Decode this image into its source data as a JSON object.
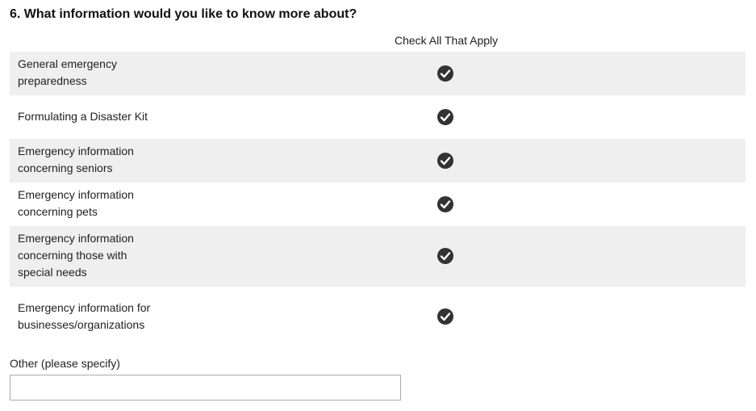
{
  "question": {
    "title": "6. What information would you like to know more about?"
  },
  "matrix": {
    "column_header": "Check All That Apply",
    "rows": [
      {
        "label": "General emergency preparedness",
        "checked": true
      },
      {
        "label": "Formulating a Disaster Kit",
        "checked": true
      },
      {
        "label": "Emergency information concerning seniors",
        "checked": true
      },
      {
        "label": "Emergency information concerning pets",
        "checked": true
      },
      {
        "label": "Emergency information concerning those with special needs",
        "checked": true
      },
      {
        "label": "Emergency information for businesses/organizations",
        "checked": true
      }
    ]
  },
  "other": {
    "label": "Other (please specify)",
    "value": ""
  },
  "icons": {
    "checked": "checkmark-circle-icon"
  },
  "colors": {
    "row_shade": "#efefef",
    "check_fill": "#333333"
  }
}
